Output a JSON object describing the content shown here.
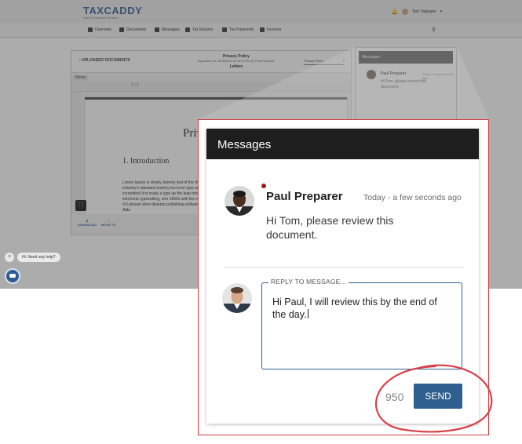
{
  "app": {
    "logo": "TAXCADDY",
    "logo_sub": "Part of Thomson Reuters",
    "user_name": "Tom Taxpayer",
    "nav": [
      {
        "label": "Overview"
      },
      {
        "label": "Documents"
      },
      {
        "label": "Messages"
      },
      {
        "label": "Tax Returns"
      },
      {
        "label": "Tax Payments"
      },
      {
        "label": "Invoices"
      }
    ]
  },
  "document": {
    "back_label": "UPLOADED DOCUMENTS",
    "title": "Privacy Policy",
    "subtitle": "Uploaded on 11/28/2023 at 03:40 PM by Paul Preparer",
    "category": "Letters",
    "select_value": "Privacy Policy",
    "home_label": "Home",
    "page_counter": "1 / 1",
    "page_title": "Priv",
    "page_heading": "1. Introduction",
    "page_body": "Lorem Ipsum is simply dummy text of the the industry's standard dummy text ever type and scrambled it to make a type sp the leap into electronic typesetting, rem 1960s with the release of Letraset shee desktop publishing software like Aldu",
    "download_label": "DOWNLOAD",
    "move_label": "MOVE TO"
  },
  "mini_messages": {
    "title": "Messages",
    "sender": "Paul Preparer",
    "time": "Today - a few seconds ago",
    "message": "Hi Tom, please review this document."
  },
  "chat_widget": {
    "hint": "Hi. Need any help?"
  },
  "messages_panel": {
    "title": "Messages",
    "sender_name": "Paul Preparer",
    "timestamp": "Today - a few seconds ago",
    "message": "Hi Tom, please review this document.",
    "reply_legend": "REPLY TO MESSAGE...",
    "reply_text": "Hi Paul, I will review this by the end of the day.",
    "char_count": "950",
    "send_label": "SEND"
  },
  "colors": {
    "brand_blue": "#2d5f8f",
    "header_dark": "#1e1e1e",
    "annotation_red": "#cf3b43",
    "online_dot": "#9f1b1b"
  }
}
